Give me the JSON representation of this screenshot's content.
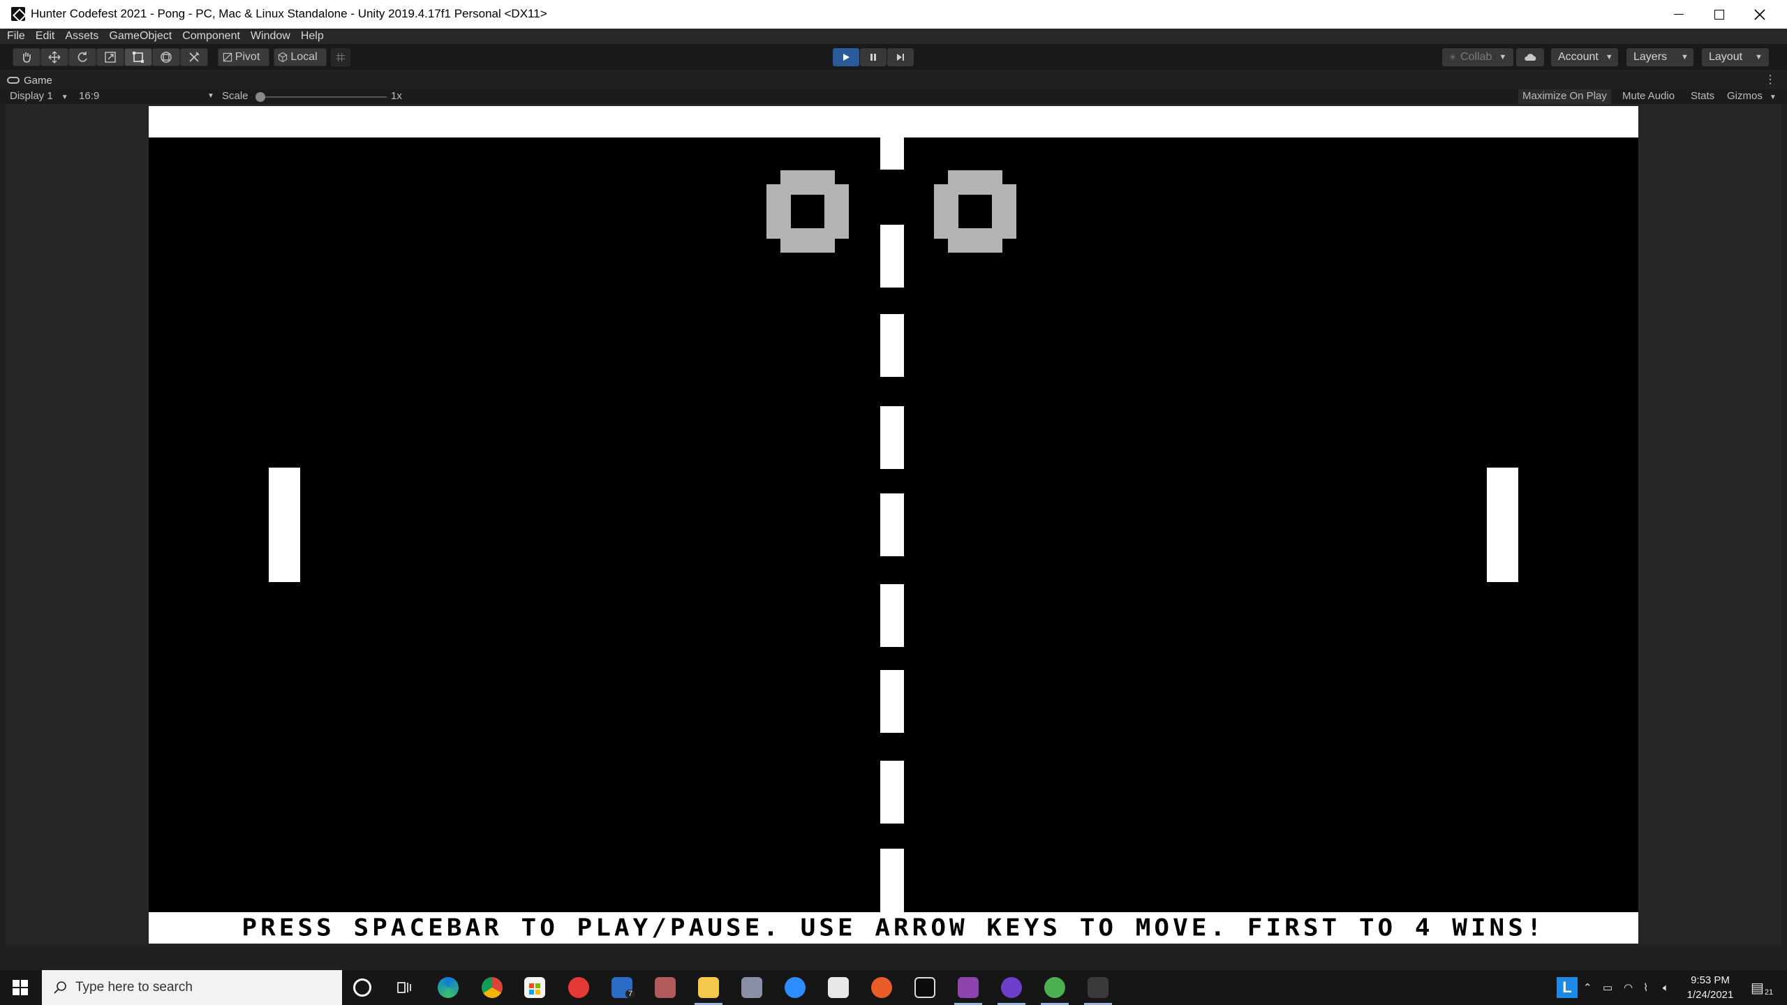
{
  "window": {
    "title": "Hunter Codefest 2021 - Pong - PC, Mac & Linux Standalone - Unity 2019.4.17f1 Personal <DX11>"
  },
  "menu": [
    "File",
    "Edit",
    "Assets",
    "GameObject",
    "Component",
    "Window",
    "Help"
  ],
  "toolbar": {
    "pivot_label": "Pivot",
    "local_label": "Local",
    "collab_label": "Collab",
    "account_label": "Account",
    "layers_label": "Layers",
    "layout_label": "Layout",
    "play_state": "playing"
  },
  "game_view": {
    "tab_label": "Game",
    "display": "Display 1",
    "aspect": "16:9",
    "scale_label": "Scale",
    "scale_value": "1x",
    "scale_fraction": 0,
    "maximize_label": "Maximize On Play",
    "mute_label": "Mute Audio",
    "stats_label": "Stats",
    "gizmos_label": "Gizmos"
  },
  "game": {
    "left_score": "0",
    "right_score": "0",
    "instructions": "PRESS SPACEBAR TO PLAY/PAUSE. USE ARROW KEYS TO MOVE. FIRST TO 4 WINS!",
    "colors": {
      "background": "#000000",
      "foreground": "#ffffff",
      "score": "#b4b4b4"
    }
  },
  "taskbar": {
    "search_placeholder": "Type here to search",
    "time": "9:53 PM",
    "date": "1/24/2021",
    "mail_badge": "7",
    "notification_count": "21",
    "tray_l_label": "L"
  }
}
